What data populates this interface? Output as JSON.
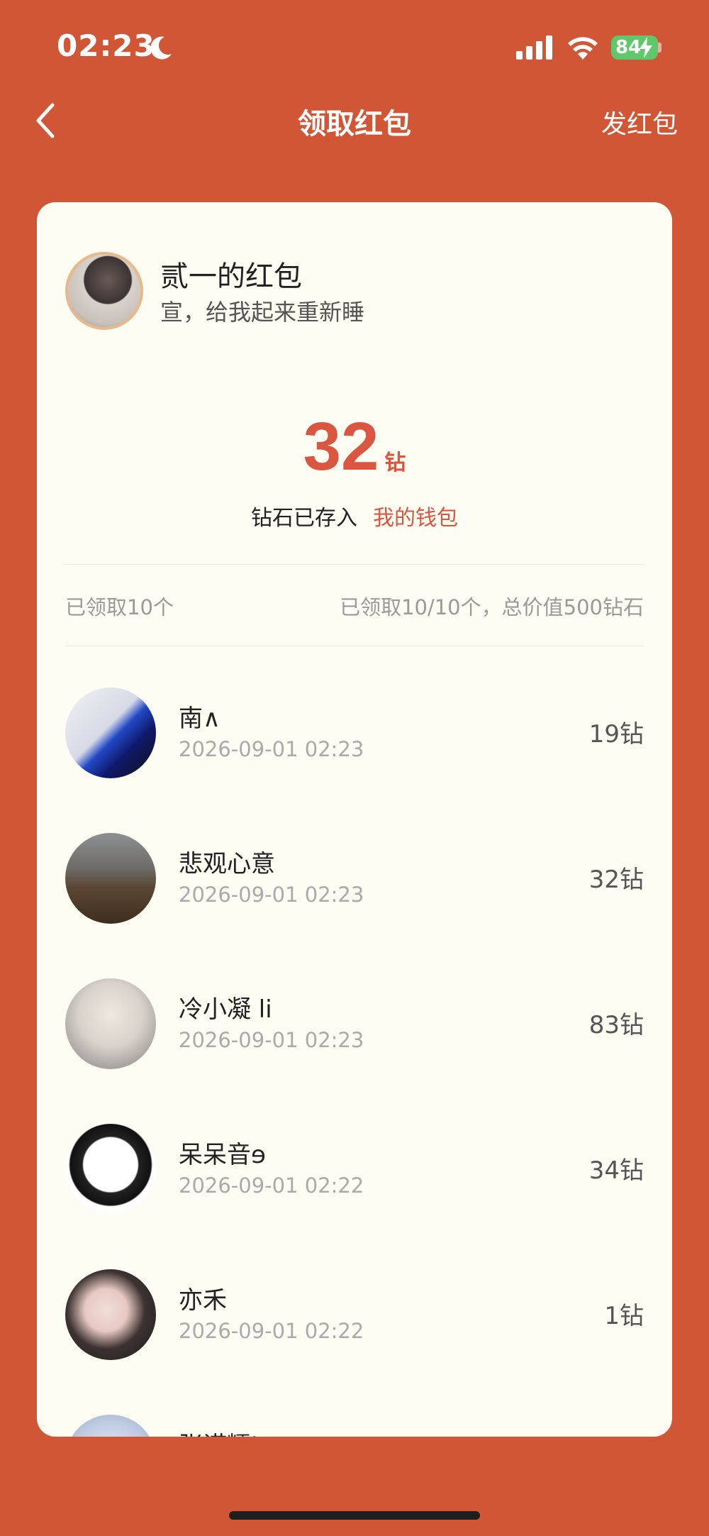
{
  "status_bar": {
    "time": "02:23",
    "battery": "84"
  },
  "nav": {
    "title": "领取红包",
    "action": "发红包"
  },
  "sender": {
    "name": "贰一的红包",
    "message": "宣，给我起来重新睡"
  },
  "received": {
    "amount": "32",
    "unit": "钻",
    "stored_text": "钻石已存入",
    "wallet_link": "我的钱包"
  },
  "summary": {
    "left": "已领取10个",
    "right": "已领取10/10个，总价值500钻石"
  },
  "claims": [
    {
      "name": "南∧",
      "time": "2026-09-01 02:23",
      "amount": "19钻"
    },
    {
      "name": "悲观心意",
      "time": "2026-09-01 02:23",
      "amount": "32钻"
    },
    {
      "name": "冷小凝 li",
      "time": "2026-09-01 02:23",
      "amount": "83钻"
    },
    {
      "name": "呆呆音ɘ",
      "time": "2026-09-01 02:22",
      "amount": "34钻"
    },
    {
      "name": "亦禾",
      "time": "2026-09-01 02:22",
      "amount": "1钻"
    },
    {
      "name": "张诺糯'",
      "time": "",
      "amount": ""
    }
  ]
}
